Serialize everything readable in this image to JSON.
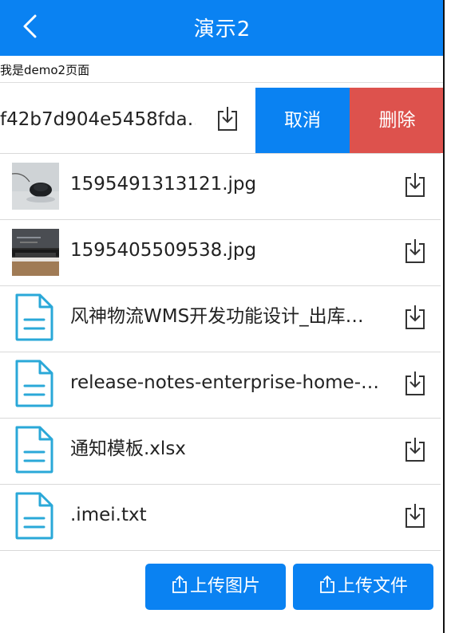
{
  "header": {
    "title": "演示2",
    "back_icon": "chevron-left-icon"
  },
  "page": {
    "subtitle": "我是demo2页面"
  },
  "swipe_item": {
    "name": "f42b7d904e5458fda…",
    "cancel_label": "取消",
    "delete_label": "删除"
  },
  "files": [
    {
      "name": "1595491313121.jpg",
      "kind": "image"
    },
    {
      "name": "1595405509538.jpg",
      "kind": "image"
    },
    {
      "name": "风神物流WMS开发功能设计_出库…",
      "kind": "document"
    },
    {
      "name": "release-notes-enterprise-home-…",
      "kind": "document"
    },
    {
      "name": "通知模板.xlsx",
      "kind": "document"
    },
    {
      "name": ".imei.txt",
      "kind": "document"
    }
  ],
  "actions": {
    "upload_image": "上传图片",
    "upload_file": "上传文件"
  },
  "colors": {
    "primary": "#0a82f2",
    "danger": "#dd524d",
    "file_icon": "#2aa8d8"
  }
}
